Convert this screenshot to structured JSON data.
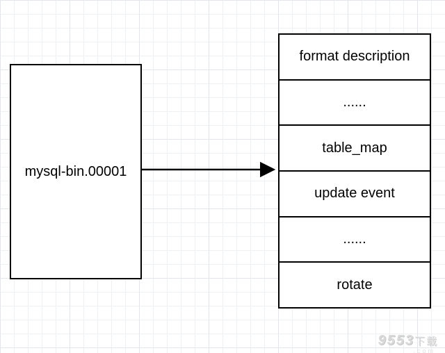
{
  "nodes": {
    "source": {
      "label": "mysql-bin.00001"
    },
    "stack": {
      "items": [
        "format description",
        "......",
        "table_map",
        "update event",
        "......",
        "rotate"
      ]
    }
  },
  "watermark": {
    "brand": "9553",
    "suffix": "下载",
    "sub": ".com"
  }
}
